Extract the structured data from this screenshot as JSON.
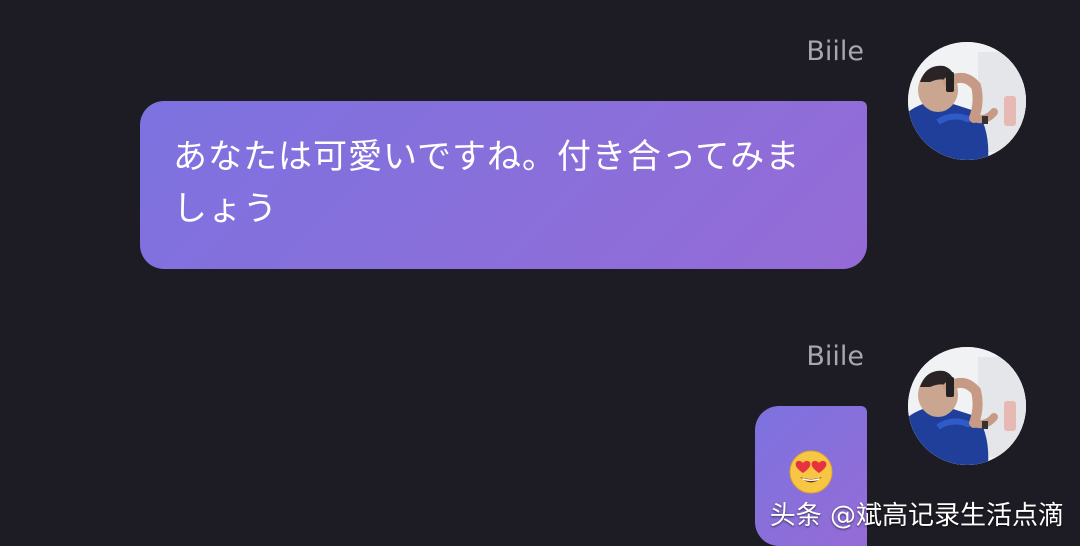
{
  "messages": [
    {
      "sender": "Biile",
      "text": "あなたは可愛いですね。付き合ってみましょう",
      "avatar_icon": "user-photo-avatar"
    },
    {
      "sender": "Biile",
      "emoji_icon": "smiling-face-with-heart-eyes-icon",
      "avatar_icon": "user-photo-avatar"
    }
  ],
  "watermark": "头条 @斌高记录生活点滴",
  "colors": {
    "background": "#1d1c25",
    "bubble_start": "#7c72e0",
    "bubble_end": "#956bd6",
    "sender_name": "#a8a7b0",
    "text": "#ffffff"
  }
}
